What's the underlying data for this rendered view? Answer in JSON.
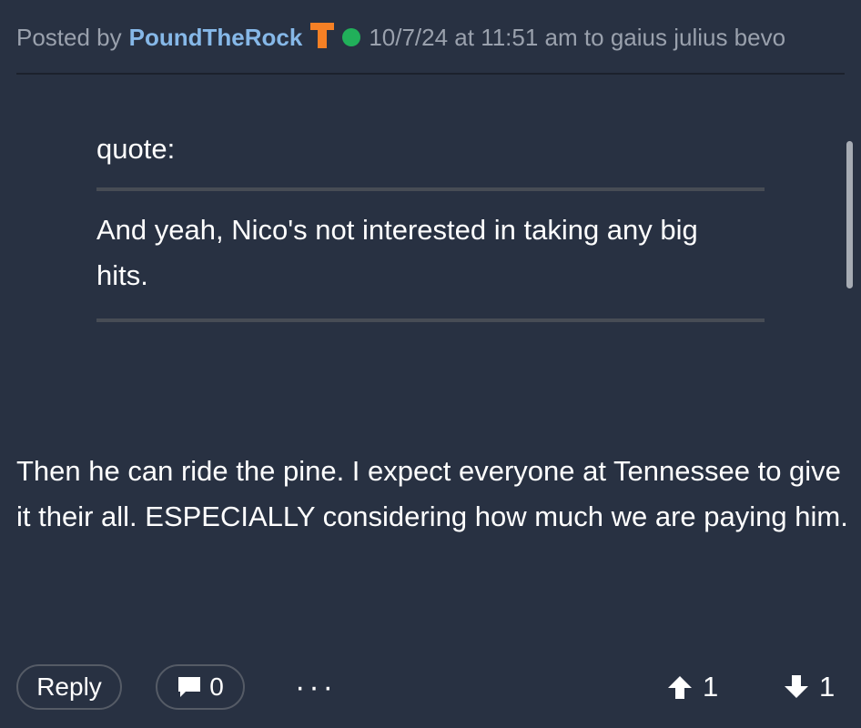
{
  "header": {
    "posted_by": "Posted by",
    "author": "PoundTheRock",
    "team_badge": "tennessee-t-icon",
    "online_status": "online",
    "timestamp": "10/7/24 at 11:51 am",
    "reply_to_prefix": "to",
    "reply_to": "gaius julius bevo",
    "colors": {
      "author": "#86b8e8",
      "team_badge": "#f58025",
      "online": "#21b05a"
    }
  },
  "quote": {
    "label": "quote:",
    "text": "And yeah, Nico's not interested in taking any big hits."
  },
  "post": {
    "body": "Then he can ride the pine. I expect everyone at Tennessee to give it their all. ESPECIALLY considering how much we are paying him."
  },
  "footer": {
    "reply_label": "Reply",
    "comment_icon": "comment-icon",
    "comment_count": "0",
    "more_label": "···",
    "upvote_icon": "up-arrow-icon",
    "upvotes": "1",
    "downvote_icon": "down-arrow-icon",
    "downvotes": "1"
  }
}
